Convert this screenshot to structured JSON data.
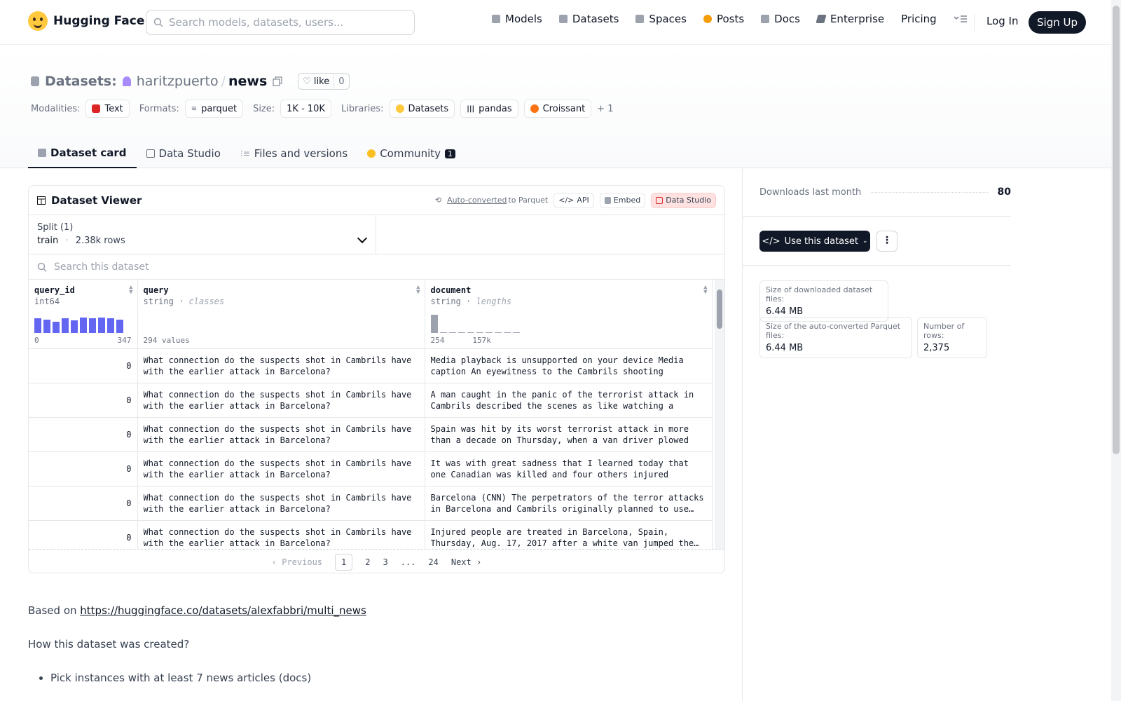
{
  "nav": {
    "brand": "Hugging Face",
    "search_placeholder": "Search models, datasets, users...",
    "items": [
      "Models",
      "Datasets",
      "Spaces",
      "Posts",
      "Docs",
      "Enterprise",
      "Pricing"
    ],
    "login": "Log In",
    "signup": "Sign Up"
  },
  "header": {
    "section": "Datasets:",
    "owner": "haritzpuerto",
    "slash": "/",
    "name": "news",
    "like_label": "like",
    "like_count": "0",
    "modalities_label": "Modalities:",
    "modality": "Text",
    "formats_label": "Formats:",
    "format": "parquet",
    "size_label": "Size:",
    "size": "1K - 10K",
    "libraries_label": "Libraries:",
    "libraries": [
      "Datasets",
      "pandas",
      "Croissant"
    ],
    "libraries_more": "+ 1"
  },
  "tabs": [
    {
      "label": "Dataset card"
    },
    {
      "label": "Data Studio"
    },
    {
      "label": "Files and versions"
    },
    {
      "label": "Community",
      "badge": "1"
    }
  ],
  "viewer": {
    "title": "Dataset Viewer",
    "auto_converted": "Auto-converted",
    "to_parquet": "to Parquet",
    "api": "API",
    "embed": "Embed",
    "data_studio": "Data Studio",
    "split_label": "Split (1)",
    "split_name": "train",
    "split_sep": "·",
    "split_rows": "2.38k rows",
    "search_placeholder": "Search this dataset",
    "columns": [
      {
        "name": "query_id",
        "type": "int64",
        "hint": "",
        "axis_min": "0",
        "axis_max": "347",
        "extra": ""
      },
      {
        "name": "query",
        "type": "string",
        "hint": "classes",
        "axis_min": "",
        "axis_max": "",
        "extra": "294 values"
      },
      {
        "name": "document",
        "type": "string",
        "hint": "lengths",
        "axis_min": "254",
        "axis_max": "157k",
        "extra": ""
      }
    ],
    "hist_query_id": [
      0.8,
      0.75,
      0.6,
      0.8,
      0.7,
      0.85,
      0.8,
      0.85,
      0.8,
      0.75
    ],
    "hist_document": [
      1,
      0.05,
      0.05,
      0.05,
      0.05,
      0,
      0,
      0,
      0,
      0.05
    ],
    "rows": [
      {
        "query_id": "0",
        "query": "What connection do the suspects shot in Cambrils have with the earlier attack in Barcelona?",
        "document": "Media playback is unsupported on your device Media caption An eyewitness to the Cambrils shooting describe…"
      },
      {
        "query_id": "0",
        "query": "What connection do the suspects shot in Cambrils have with the earlier attack in Barcelona?",
        "document": "A man caught in the panic of the terrorist attack in Cambrils described the scenes as like watching a \"horro…"
      },
      {
        "query_id": "0",
        "query": "What connection do the suspects shot in Cambrils have with the earlier attack in Barcelona?",
        "document": "Spain was hit by its worst terrorist attack in more than a decade on Thursday, when a van driver plowed into…"
      },
      {
        "query_id": "0",
        "query": "What connection do the suspects shot in Cambrils have with the earlier attack in Barcelona?",
        "document": "It was with great sadness that I learned today that one Canadian was killed and four others injured during…"
      },
      {
        "query_id": "0",
        "query": "What connection do the suspects shot in Cambrils have with the earlier attack in Barcelona?",
        "document": "Barcelona (CNN) The perpetrators of the terror attacks in Barcelona and Cambrils originally planned to use…"
      },
      {
        "query_id": "0",
        "query": "What connection do the suspects shot in Cambrils have with the earlier attack in Barcelona?",
        "document": "Injured people are treated in Barcelona, Spain, Thursday, Aug. 17, 2017 after a white van jumped the…"
      }
    ],
    "pager": {
      "prev": "Previous",
      "pages": [
        "1",
        "2",
        "3",
        "...",
        "24"
      ],
      "next": "Next"
    }
  },
  "card": {
    "based_on": "Based on",
    "link": "https://huggingface.co/datasets/alexfabbri/multi_news",
    "how": "How this dataset was created?",
    "bullet": "Pick instances with at least 7 news articles (docs)"
  },
  "sidebar": {
    "downloads_label": "Downloads last month",
    "downloads_value": "80",
    "use_button": "Use this dataset",
    "more": "⋮",
    "stats": [
      {
        "label": "Size of downloaded dataset files:",
        "value": "6.44 MB"
      },
      {
        "label": "Size of the auto-converted Parquet files:",
        "value": "6.44 MB"
      },
      {
        "label": "Number of rows:",
        "value": "2,375"
      }
    ]
  }
}
